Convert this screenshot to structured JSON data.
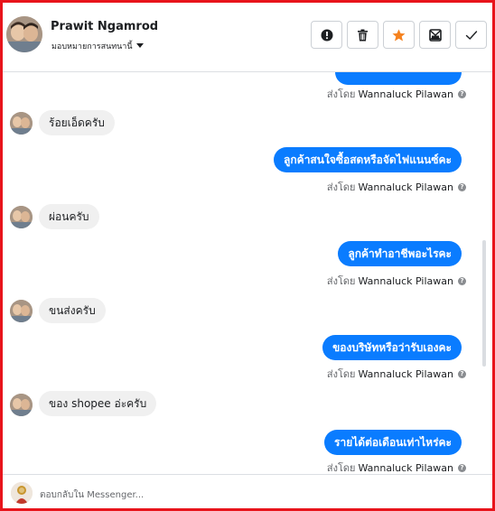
{
  "header": {
    "contact_name": "Prawit Ngamrod",
    "assign_label": "มอบหมายการสนทนานี้",
    "actions": [
      {
        "icon": "alert-icon"
      },
      {
        "icon": "trash-icon"
      },
      {
        "icon": "star-icon",
        "color": "#f5821f"
      },
      {
        "icon": "spam-icon"
      },
      {
        "icon": "check-icon"
      }
    ]
  },
  "thread": {
    "sent_by_prefix": "ส่งโดย",
    "sender_name": "Wannaluck Pilawan",
    "messages": [
      {
        "direction": "out",
        "text": "",
        "partial": true
      },
      {
        "direction": "in",
        "text": "ร้อยเอ็ดครับ"
      },
      {
        "direction": "out",
        "text": "ลูกค้าสนใจซื้อสดหรือจัดไฟแนนซ์คะ"
      },
      {
        "direction": "in",
        "text": "ผ่อนครับ"
      },
      {
        "direction": "out",
        "text": "ลูกค้าทำอาชีพอะไรคะ"
      },
      {
        "direction": "in",
        "text": "ขนส่งครับ"
      },
      {
        "direction": "out",
        "text": "ของบริษัทหรือว่ารับเองคะ"
      },
      {
        "direction": "in",
        "text": "ของ shopee อ่ะครับ"
      },
      {
        "direction": "out",
        "text": "รายได้ต่อเดือนเท่าไหร่คะ"
      }
    ]
  },
  "composer": {
    "placeholder": "ตอบกลับใน Messenger..."
  },
  "colors": {
    "outgoing_bubble": "#0a7cff",
    "incoming_bubble": "#f0f0f0",
    "frame_border": "#e8141b"
  }
}
